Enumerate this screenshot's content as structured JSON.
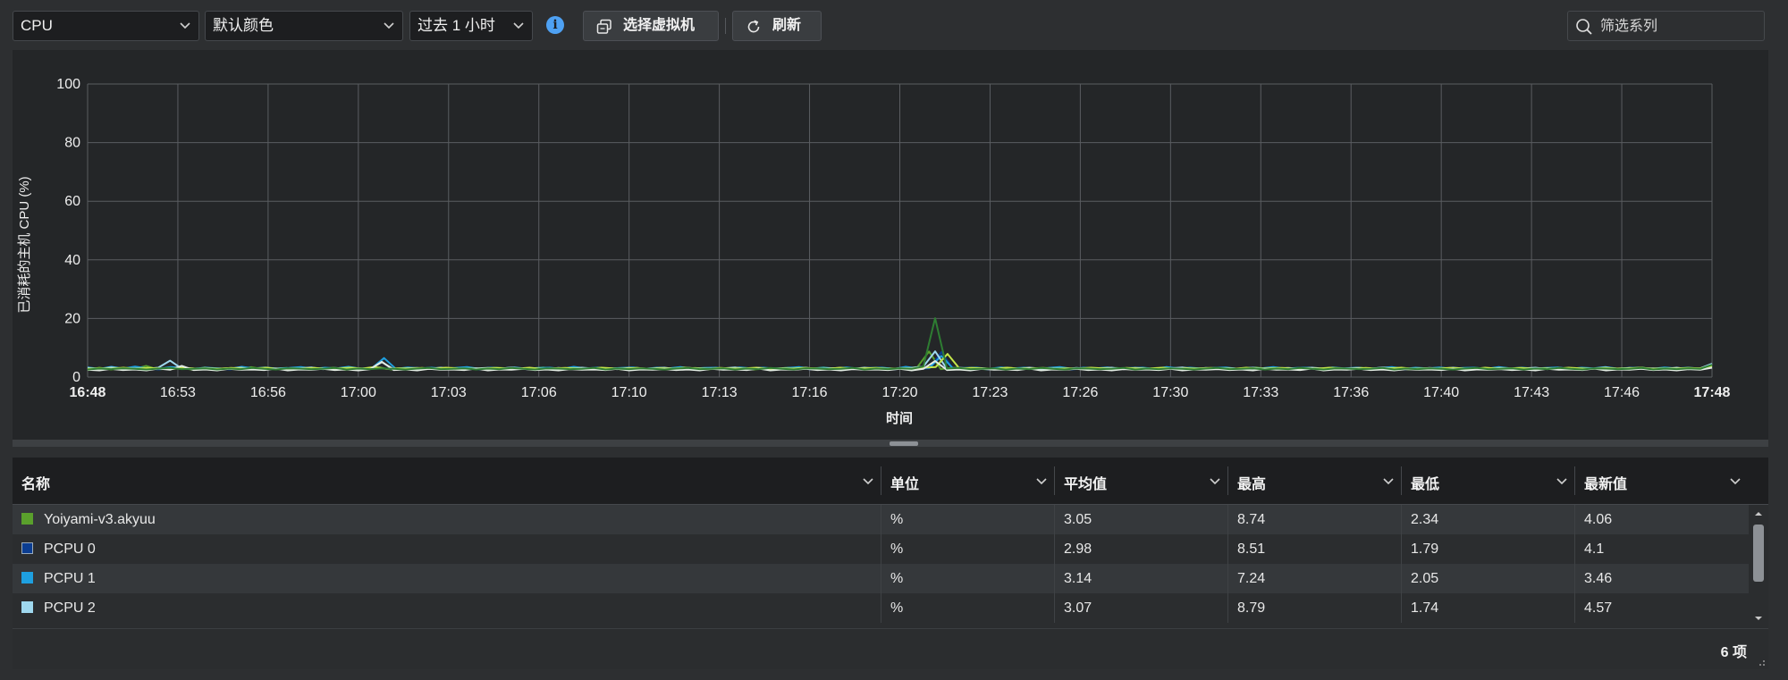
{
  "toolbar": {
    "metric_select": "CPU",
    "color_select": "默认颜色",
    "time_select": "过去 1 小时",
    "info_icon": "i",
    "select_vm_label": "选择虚拟机",
    "refresh_label": "刷新",
    "search_placeholder": "筛选系列"
  },
  "chart_data": {
    "type": "line",
    "xlabel": "时间",
    "ylabel": "已消耗的主机 CPU (%)",
    "ylim": [
      0,
      100
    ],
    "yticks": [
      "0",
      "20",
      "40",
      "60",
      "80",
      "100"
    ],
    "xticks": [
      "16:48",
      "16:53",
      "16:56",
      "17:00",
      "17:03",
      "17:06",
      "17:10",
      "17:13",
      "17:16",
      "17:20",
      "17:23",
      "17:26",
      "17:30",
      "17:33",
      "17:36",
      "17:40",
      "17:43",
      "17:46",
      "17:48"
    ],
    "grid": true,
    "series": [
      {
        "name": "Yoiyami-v3.akyuu",
        "color": "#5aa02c",
        "values": [
          2.4,
          3.2,
          2.6,
          3.0,
          2.7,
          3.8,
          2.6,
          2.9,
          3.1,
          2.5,
          3.3,
          2.8,
          3.0,
          2.6,
          3.4,
          2.7,
          2.9,
          3.1,
          2.6,
          3.0,
          2.8,
          3.2,
          2.5,
          3.0,
          2.9,
          3.3,
          2.6,
          2.8,
          3.0,
          2.7,
          3.1,
          2.9,
          2.6,
          3.0,
          2.8,
          3.2,
          3.0,
          2.7,
          2.9,
          3.3,
          2.6,
          2.8,
          3.0,
          2.7,
          3.1,
          2.9,
          2.5,
          3.0,
          2.8,
          3.2,
          2.7,
          2.9,
          3.1,
          2.6,
          3.0,
          2.8,
          3.1,
          2.6,
          3.0,
          2.9,
          3.2,
          2.7,
          2.9,
          3.3,
          2.6,
          2.8,
          3.0,
          2.7,
          3.1,
          2.9,
          3.0,
          3.4,
          8.74,
          2.7,
          3.2,
          2.8,
          3.0,
          2.6,
          2.9,
          3.1,
          2.7,
          3.0,
          2.8,
          3.2,
          2.6,
          2.9,
          3.0,
          2.7,
          3.1,
          2.8,
          3.0,
          2.6,
          3.2,
          2.9,
          2.7,
          3.0,
          2.8,
          3.1,
          2.6,
          2.9,
          3.3,
          2.7,
          3.0,
          2.8,
          3.1,
          2.9,
          2.6,
          3.0,
          2.8,
          3.2,
          2.7,
          2.9,
          3.1,
          2.6,
          3.0,
          2.8,
          3.1,
          2.7,
          2.9,
          3.0,
          2.6,
          3.2,
          2.8,
          3.0,
          2.7,
          2.9,
          3.1,
          2.6,
          3.0,
          2.8,
          3.2,
          2.7,
          2.9,
          3.3,
          2.6,
          3.0,
          2.8,
          3.1,
          2.7,
          4.06
        ]
      },
      {
        "name": "PCPU 0",
        "color": "#0b3d91",
        "values": [
          3.0,
          2.6,
          3.2,
          2.8,
          3.0,
          2.9,
          2.6,
          3.1,
          2.8,
          2.7,
          3.0,
          2.9,
          2.6,
          3.2,
          2.8,
          3.0,
          2.7,
          2.9,
          3.1,
          2.6,
          3.0,
          2.8,
          3.2,
          2.7,
          2.9,
          3.0,
          2.6,
          3.1,
          2.8,
          3.0,
          2.7,
          2.9,
          3.2,
          2.6,
          3.0,
          2.8,
          3.1,
          2.7,
          2.9,
          3.0,
          2.6,
          3.2,
          2.8,
          3.0,
          2.7,
          2.9,
          3.1,
          2.6,
          3.0,
          2.8,
          3.2,
          2.7,
          2.9,
          3.0,
          2.6,
          3.1,
          2.8,
          3.0,
          2.7,
          2.9,
          3.2,
          2.6,
          3.0,
          2.8,
          3.1,
          2.7,
          2.9,
          3.0,
          2.6,
          3.2,
          2.8,
          3.0,
          8.51,
          2.7,
          2.9,
          3.0,
          2.6,
          3.1,
          2.8,
          3.0,
          2.7,
          2.9,
          3.2,
          2.6,
          3.0,
          2.8,
          3.1,
          2.7,
          2.9,
          3.0,
          2.6,
          3.2,
          2.8,
          3.0,
          2.7,
          2.9,
          3.1,
          2.6,
          3.0,
          2.8,
          3.2,
          2.7,
          2.9,
          3.0,
          2.6,
          3.1,
          2.8,
          3.0,
          2.7,
          2.9,
          3.2,
          2.6,
          3.0,
          2.8,
          3.1,
          2.7,
          2.9,
          3.0,
          2.6,
          3.2,
          2.8,
          3.0,
          2.7,
          2.9,
          3.1,
          2.6,
          3.0,
          2.8,
          3.2,
          2.7,
          2.9,
          3.0,
          2.6,
          3.1,
          2.8,
          3.0,
          2.7,
          4.1
        ]
      },
      {
        "name": "PCPU 1",
        "color": "#1ea0e0",
        "values": [
          3.3,
          2.8,
          3.5,
          2.9,
          3.6,
          3.0,
          2.8,
          3.4,
          3.1,
          2.9,
          3.2,
          3.0,
          2.8,
          3.5,
          3.0,
          3.3,
          2.9,
          3.1,
          3.4,
          2.8,
          3.2,
          3.0,
          3.5,
          2.9,
          3.1,
          6.5,
          2.8,
          3.3,
          3.0,
          3.2,
          2.9,
          3.1,
          3.4,
          2.8,
          3.2,
          3.0,
          3.3,
          2.9,
          3.1,
          3.2,
          2.8,
          3.5,
          3.0,
          3.2,
          2.9,
          3.1,
          3.3,
          2.8,
          3.2,
          3.0,
          3.4,
          2.9,
          3.1,
          3.2,
          2.8,
          3.3,
          3.0,
          3.2,
          2.9,
          3.1,
          3.4,
          2.8,
          3.2,
          3.0,
          3.3,
          2.9,
          3.1,
          3.2,
          2.8,
          3.5,
          3.0,
          3.2,
          7.24,
          2.9,
          3.1,
          3.2,
          2.8,
          3.3,
          3.0,
          3.2,
          2.9,
          3.1,
          3.4,
          2.8,
          3.2,
          3.0,
          3.3,
          2.9,
          3.1,
          3.2,
          2.8,
          3.4,
          3.0,
          3.2,
          2.9,
          3.1,
          3.3,
          2.8,
          3.2,
          3.0,
          3.4,
          2.9,
          3.1,
          3.2,
          2.8,
          3.3,
          3.0,
          3.2,
          2.9,
          3.1,
          3.4,
          2.8,
          3.2,
          3.0,
          3.3,
          2.9,
          3.1,
          3.2,
          2.8,
          3.4,
          3.0,
          3.2,
          2.9,
          3.1,
          3.3,
          2.8,
          3.2,
          3.0,
          3.4,
          2.9,
          3.1,
          3.2,
          2.8,
          3.3,
          3.0,
          3.2,
          2.9,
          3.46
        ]
      },
      {
        "name": "PCPU 2",
        "color": "#9fd8ee",
        "values": [
          3.1,
          2.7,
          3.3,
          2.9,
          3.0,
          2.8,
          3.2,
          5.6,
          2.9,
          2.7,
          3.1,
          2.8,
          3.0,
          3.2,
          2.7,
          3.1,
          2.9,
          2.8,
          3.0,
          3.3,
          2.7,
          3.1,
          2.9,
          3.0,
          2.8,
          5.1,
          2.7,
          3.0,
          3.1,
          2.8,
          3.2,
          2.9,
          2.7,
          3.0,
          3.1,
          2.8,
          3.3,
          2.9,
          3.0,
          2.7,
          3.1,
          2.8,
          3.2,
          2.9,
          3.0,
          2.7,
          3.1,
          2.8,
          3.0,
          3.2,
          2.7,
          3.1,
          2.9,
          2.8,
          3.0,
          3.3,
          2.7,
          3.1,
          2.9,
          3.0,
          2.8,
          3.2,
          2.7,
          3.0,
          3.1,
          2.8,
          3.2,
          2.9,
          2.7,
          3.0,
          3.1,
          3.6,
          8.79,
          2.8,
          3.2,
          2.9,
          3.0,
          2.7,
          3.1,
          2.8,
          3.2,
          2.9,
          3.0,
          2.7,
          3.1,
          2.8,
          3.0,
          3.2,
          2.7,
          3.1,
          2.9,
          2.8,
          3.0,
          3.3,
          2.7,
          3.1,
          2.9,
          3.0,
          2.8,
          3.2,
          2.7,
          3.0,
          3.1,
          2.8,
          3.2,
          2.9,
          2.7,
          3.0,
          3.1,
          2.8,
          3.3,
          2.9,
          3.0,
          2.7,
          3.1,
          2.8,
          3.2,
          2.9,
          3.0,
          2.7,
          3.1,
          2.8,
          3.0,
          3.2,
          2.7,
          3.1,
          2.9,
          2.8,
          3.0,
          3.3,
          2.7,
          3.1,
          2.9,
          3.0,
          2.8,
          3.2,
          2.7,
          3.0,
          4.57
        ]
      },
      {
        "color": "#c6e84a",
        "values": [
          2.8,
          3.0,
          2.9,
          3.2,
          2.8,
          3.1,
          3.0,
          2.7,
          3.2,
          2.9,
          3.0,
          2.8,
          3.1,
          2.9,
          3.0,
          3.2,
          2.7,
          3.0,
          2.9,
          3.1,
          2.8,
          3.0,
          3.2,
          2.9,
          3.4,
          2.8,
          3.0,
          2.9,
          3.1,
          2.8,
          3.2,
          3.0,
          2.9,
          2.8,
          3.1,
          3.0,
          2.9,
          3.2,
          2.8,
          3.0,
          3.1,
          2.9,
          2.8,
          3.2,
          3.0,
          2.9,
          3.1,
          2.8,
          3.0,
          2.9,
          3.2,
          3.0,
          2.8,
          3.1,
          2.9,
          3.0,
          3.2,
          2.8,
          3.0,
          2.9,
          3.1,
          3.0,
          2.8,
          3.2,
          2.9,
          3.0,
          3.1,
          2.8,
          3.0,
          2.9,
          3.2,
          3.4,
          7.9,
          2.9,
          3.1,
          3.0,
          2.8,
          3.2,
          2.9,
          3.0,
          3.1,
          2.8,
          3.0,
          2.9,
          3.2,
          3.0,
          2.8,
          3.1,
          2.9,
          3.0,
          3.2,
          2.8,
          3.0,
          2.9,
          3.1,
          3.0,
          2.8,
          3.2,
          2.9,
          3.0,
          3.1,
          2.8,
          3.0,
          2.9,
          3.2,
          3.0,
          2.8,
          3.1,
          2.9,
          3.0,
          3.2,
          2.8,
          3.0,
          2.9,
          3.1,
          3.0,
          2.8,
          3.2,
          2.9,
          3.0,
          3.1,
          2.8,
          3.0,
          2.9,
          3.2,
          3.0,
          2.8,
          3.1,
          2.9,
          3.0,
          3.2,
          2.8,
          3.0,
          2.9,
          3.1,
          3.0,
          3.8
        ]
      },
      {
        "color": "#e3ece4",
        "values": [
          2.5,
          2.3,
          2.8,
          2.4,
          2.6,
          2.3,
          2.9,
          2.5,
          3.8,
          2.4,
          2.6,
          2.3,
          2.8,
          2.5,
          2.6,
          2.4,
          2.9,
          2.3,
          2.6,
          2.5,
          2.8,
          2.4,
          2.6,
          2.3,
          2.7,
          5.2,
          2.4,
          2.6,
          2.3,
          2.8,
          2.5,
          2.6,
          2.4,
          2.9,
          2.3,
          2.6,
          2.5,
          2.8,
          2.4,
          2.6,
          2.3,
          2.7,
          2.5,
          2.6,
          2.4,
          2.8,
          2.3,
          2.6,
          2.5,
          2.7,
          2.4,
          2.6,
          2.3,
          2.8,
          2.5,
          2.6,
          2.4,
          2.9,
          2.3,
          2.6,
          2.5,
          2.8,
          2.4,
          2.6,
          2.3,
          2.7,
          2.5,
          2.6,
          2.4,
          2.8,
          2.3,
          2.8,
          5.5,
          2.4,
          2.6,
          2.3,
          2.8,
          2.5,
          2.6,
          2.4,
          2.9,
          2.3,
          2.6,
          2.5,
          2.8,
          2.4,
          2.6,
          2.3,
          2.7,
          2.5,
          2.6,
          2.4,
          2.8,
          2.3,
          2.6,
          2.5,
          2.7,
          2.4,
          2.6,
          2.3,
          2.8,
          2.5,
          2.6,
          2.4,
          2.9,
          2.3,
          2.6,
          2.5,
          2.8,
          2.4,
          2.6,
          2.3,
          2.7,
          2.5,
          2.6,
          2.4,
          2.8,
          2.3,
          2.6,
          2.5,
          2.7,
          2.4,
          2.6,
          2.3,
          2.8,
          2.5,
          2.6,
          2.4,
          2.9,
          2.3,
          2.6,
          2.5,
          2.8,
          2.4,
          2.6,
          2.3,
          2.7,
          2.5,
          3.2
        ]
      },
      {
        "color": "#2e7d32",
        "values": [
          2.6,
          2.9,
          2.7,
          3.0,
          2.8,
          2.6,
          2.9,
          3.1,
          2.7,
          2.8,
          3.0,
          2.6,
          2.9,
          2.7,
          3.1,
          2.8,
          2.6,
          3.0,
          2.9,
          2.7,
          2.8,
          3.1,
          2.6,
          2.9,
          2.7,
          3.0,
          2.8,
          2.6,
          2.9,
          3.1,
          2.7,
          2.8,
          3.0,
          2.6,
          2.9,
          2.7,
          3.1,
          2.8,
          2.6,
          3.0,
          2.9,
          2.7,
          2.8,
          3.1,
          2.6,
          2.9,
          2.7,
          3.0,
          2.8,
          2.6,
          2.9,
          3.1,
          2.7,
          2.8,
          3.0,
          2.6,
          2.9,
          2.7,
          3.1,
          2.8,
          2.6,
          3.0,
          2.9,
          2.7,
          2.8,
          3.1,
          2.6,
          2.9,
          2.7,
          3.0,
          2.8,
          3.6,
          20.1,
          2.9,
          3.1,
          2.7,
          2.8,
          3.0,
          2.6,
          2.9,
          2.7,
          3.1,
          2.8,
          2.6,
          3.0,
          2.9,
          2.7,
          2.8,
          3.1,
          2.6,
          2.9,
          2.7,
          3.0,
          2.8,
          2.6,
          2.9,
          3.1,
          2.7,
          2.8,
          3.0,
          2.6,
          2.9,
          2.7,
          3.1,
          2.8,
          2.6,
          3.0,
          2.9,
          2.7,
          2.8,
          3.1,
          2.6,
          2.9,
          2.7,
          3.0,
          2.8,
          2.6,
          2.9,
          3.1,
          2.7,
          2.8,
          3.0,
          2.6,
          2.9,
          2.7,
          3.1,
          2.8,
          2.6,
          3.0,
          2.9,
          2.7,
          2.8,
          3.1,
          2.6,
          2.9,
          2.7,
          3.0,
          2.8,
          4.2
        ]
      }
    ]
  },
  "table": {
    "columns": [
      "名称",
      "单位",
      "平均值",
      "最高",
      "最低",
      "最新值"
    ],
    "rows": [
      {
        "name": "Yoiyami-v3.akyuu",
        "color": "#5aa02c",
        "unit": "%",
        "avg": "3.05",
        "max": "8.74",
        "min": "2.34",
        "latest": "4.06"
      },
      {
        "name": "PCPU 0",
        "color": "#0b3d91",
        "unit": "%",
        "avg": "2.98",
        "max": "8.51",
        "min": "1.79",
        "latest": "4.1"
      },
      {
        "name": "PCPU 1",
        "color": "#1ea0e0",
        "unit": "%",
        "avg": "3.14",
        "max": "7.24",
        "min": "2.05",
        "latest": "3.46"
      },
      {
        "name": "PCPU 2",
        "color": "#9fd8ee",
        "unit": "%",
        "avg": "3.07",
        "max": "8.79",
        "min": "1.74",
        "latest": "4.57"
      }
    ],
    "count_label": "6 项"
  },
  "theme": {
    "accent": "#4ea1f3",
    "background": "#2d2f31",
    "panel": "#242628",
    "grid": "#5a5d61"
  }
}
